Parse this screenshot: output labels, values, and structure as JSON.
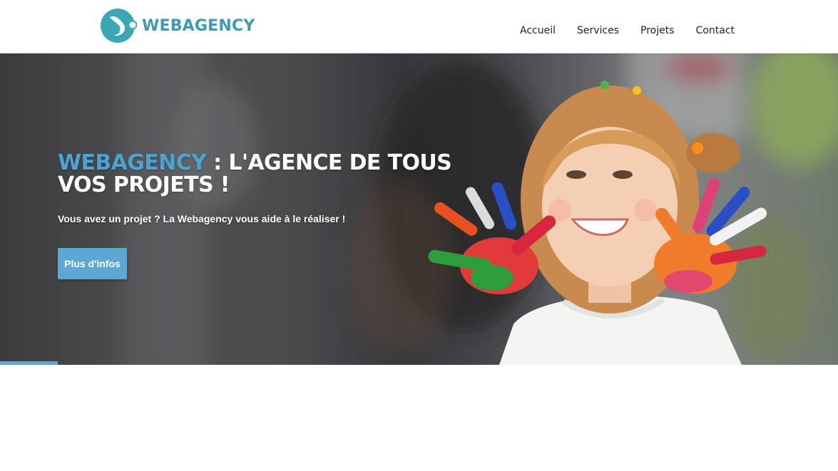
{
  "brand": {
    "name": "WEBAGENCY",
    "colors": {
      "accent": "#3d9ab3",
      "button": "#5aa8d3",
      "title_accent": "#4ca3d1"
    }
  },
  "nav": {
    "items": [
      {
        "label": "Accueil"
      },
      {
        "label": "Services"
      },
      {
        "label": "Projets"
      },
      {
        "label": "Contact"
      }
    ]
  },
  "hero": {
    "title_accent": "WEBAGENCY",
    "title_rest": " : L'AGENCE DE TOUS VOS PROJETS !",
    "subtitle": "Vous avez un projet ? La Webagency vous aide à le réaliser !",
    "button_label": "Plus d'infos",
    "image_icon": "smiling-girl-painted-hands-photo",
    "active_slide": 1
  }
}
